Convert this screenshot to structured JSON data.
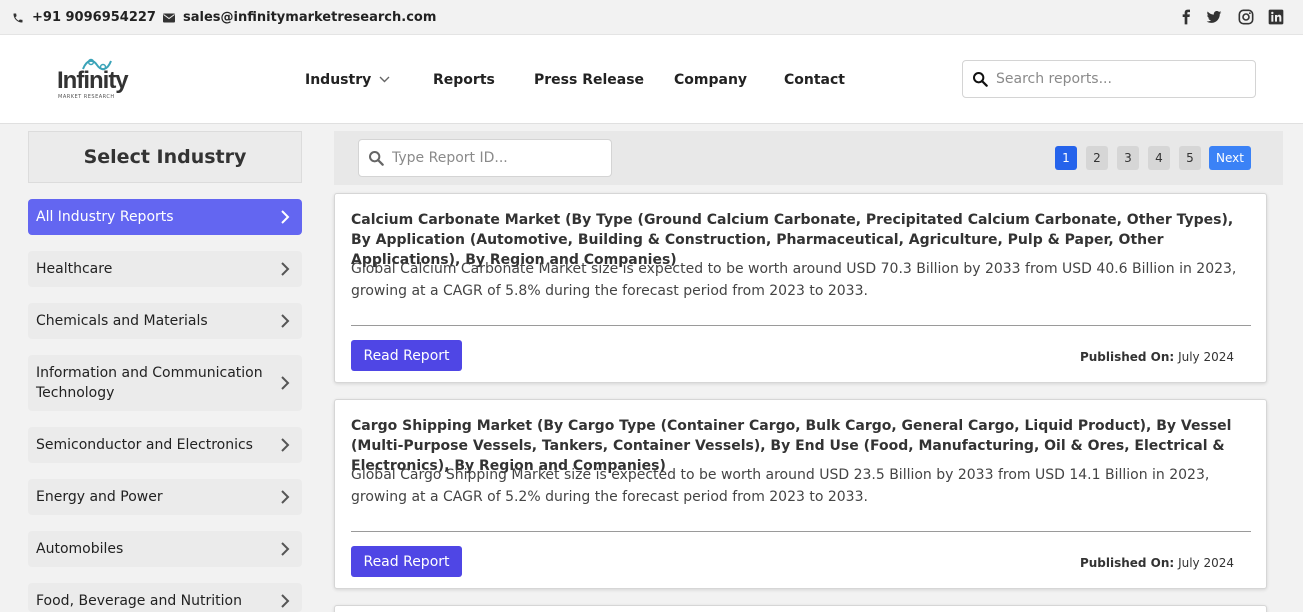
{
  "topbar": {
    "phone": "+91 9096954227",
    "email": "sales@infinitymarketresearch.com",
    "social_icons": [
      "facebook-icon",
      "twitter-icon",
      "instagram-icon",
      "linkedin-icon"
    ]
  },
  "logo": {
    "title": "Infinity",
    "subtitle": "MARKET RESEARCH"
  },
  "nav": {
    "items": [
      "Industry",
      "Reports",
      "Press Release",
      "Company",
      "Contact"
    ]
  },
  "search": {
    "placeholder": "Search reports..."
  },
  "sidebar": {
    "title": "Select Industry",
    "items": [
      "All Industry Reports",
      "Healthcare",
      "Chemicals and Materials",
      "Information and Communication Technology",
      "Semiconductor and Electronics",
      "Energy and Power",
      "Automobiles",
      "Food, Beverage and Nutrition"
    ]
  },
  "main": {
    "report_id_placeholder": "Type Report ID...",
    "pagination": [
      "1",
      "2",
      "3",
      "4",
      "5"
    ],
    "next_label": "Next",
    "read_label": "Read Report",
    "published_label": "Published On:",
    "reports": [
      {
        "title": "Calcium Carbonate Market (By Type (Ground Calcium Carbonate, Precipitated Calcium Carbonate, Other Types), By Application (Automotive, Building & Construction, Pharmaceutical, Agriculture, Pulp & Paper, Other Applications), By Region and Companies)",
        "description": "Global Calcium Carbonate Market size is expected to be worth around USD 70.3 Billion by 2033 from USD 40.6 Billion in 2023, growing at a CAGR of 5.8% during the forecast period from 2023 to 2033.",
        "published": "July 2024"
      },
      {
        "title": "Cargo Shipping Market (By Cargo Type (Container Cargo, Bulk Cargo, General Cargo, Liquid Product), By Vessel (Multi-Purpose Vessels, Tankers, Container Vessels), By End Use (Food, Manufacturing, Oil & Ores, Electrical & Electronics), By Region and Companies)",
        "description": "Global Cargo Shipping Market size is expected to be worth around USD 23.5 Billion by 2033 from USD 14.1 Billion in 2023, growing at a CAGR of 5.2% during the forecast period from 2023 to 2033.",
        "published": "July 2024"
      }
    ]
  },
  "colors": {
    "accent": "#6366f1",
    "button": "#4f46e5",
    "page_active": "#2563eb",
    "next": "#3b82f6"
  }
}
